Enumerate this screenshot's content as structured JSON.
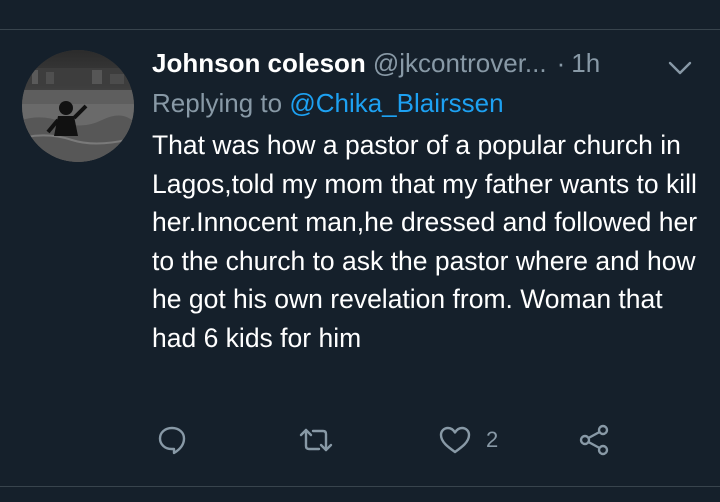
{
  "tweet": {
    "display_name": "Johnson coleson",
    "handle": "@jkcontrover...",
    "separator": "·",
    "time": "1h",
    "replying_prefix": "Replying to",
    "replying_to": "@Chika_Blairssen",
    "text": "That was how a pastor of a popular church in Lagos,told my mom that my father wants to kill her.Innocent man,he dressed and followed her to the church to ask the pastor where and how he got his own revelation from. Woman that had 6 kids for him"
  },
  "actions": {
    "like_count": "2"
  },
  "colors": {
    "background": "#15202b",
    "secondary_text": "#8899a6",
    "link": "#1da1f2",
    "divider": "#38444d"
  },
  "icons": {
    "menu": "chevron-down-icon",
    "reply": "comment-bubble-icon",
    "retweet": "retweet-icon",
    "like": "heart-icon",
    "share": "share-icon"
  }
}
